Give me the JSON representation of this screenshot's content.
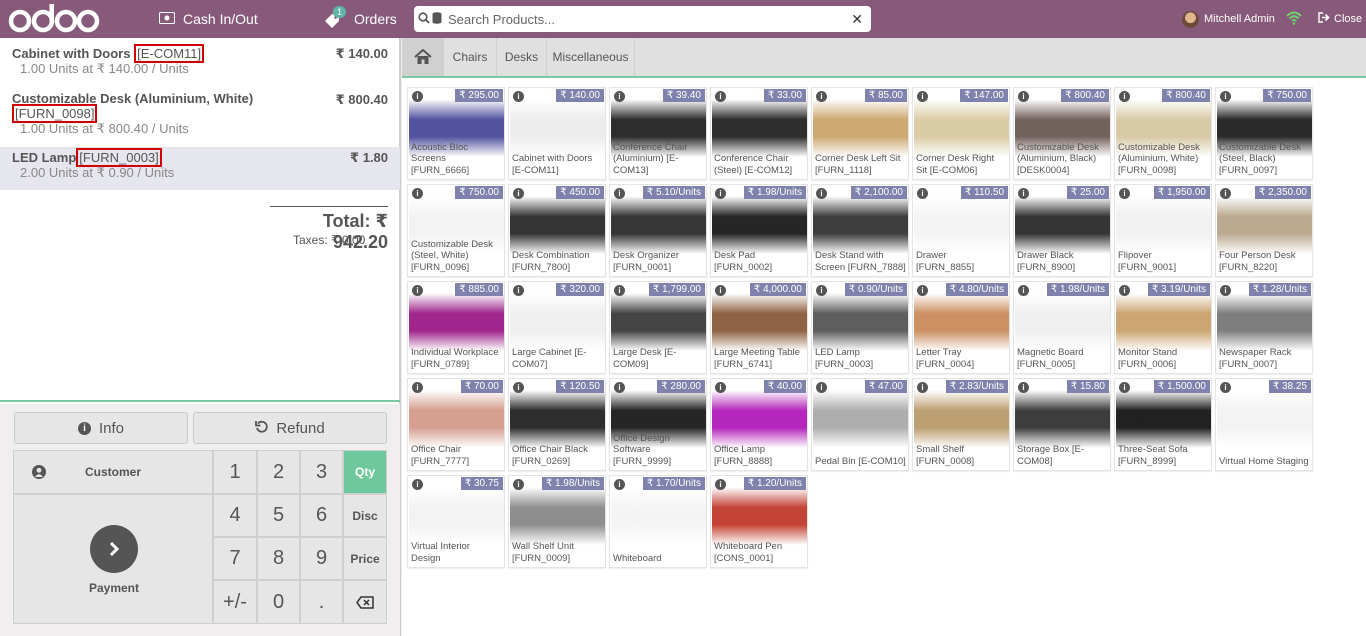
{
  "header": {
    "cash_label": "Cash In/Out",
    "orders_label": "Orders",
    "orders_badge": "1",
    "search_placeholder": "Search Products...",
    "user_name": "Mitchell Admin",
    "close_label": "Close"
  },
  "order": {
    "lines": [
      {
        "name": "Cabinet with Doors",
        "ref": "[E-COM11]",
        "price": "₹ 140.00",
        "info": "1.00 Units at ₹ 140.00 / Units"
      },
      {
        "name": "Customizable Desk (Aluminium, White)",
        "ref": "[FURN_0098]",
        "price": "₹ 800.40",
        "info": "1.00 Units at ₹ 800.40 / Units"
      },
      {
        "name": "LED Lamp",
        "ref": "[FURN_0003]",
        "price": "₹ 1.80",
        "info": "2.00 Units at ₹ 0.90 / Units"
      }
    ],
    "total": "Total: ₹ 942.20",
    "taxes": "Taxes: ₹ 0.00"
  },
  "controls": {
    "info_label": "Info",
    "refund_label": "Refund",
    "customer_label": "Customer",
    "payment_label": "Payment",
    "keys": [
      "1",
      "2",
      "3",
      "4",
      "5",
      "6",
      "7",
      "8",
      "9",
      "+/-",
      "0",
      "."
    ],
    "modes": [
      "Qty",
      "Disc",
      "Price"
    ],
    "active_mode": "Qty"
  },
  "categories": [
    "Chairs",
    "Desks",
    "Miscellaneous"
  ],
  "products": [
    {
      "name": "Acoustic Bloc Screens [FURN_6666]",
      "price": "₹ 295.00",
      "color": "#4a4a9a"
    },
    {
      "name": "Cabinet with Doors [E-COM11]",
      "price": "₹ 140.00",
      "color": "#ececec"
    },
    {
      "name": "Conference Chair (Aluminium) [E-COM13]",
      "price": "₹ 39.40",
      "color": "#222222"
    },
    {
      "name": "Conference Chair (Steel) [E-COM12]",
      "price": "₹ 33.00",
      "color": "#222222"
    },
    {
      "name": "Corner Desk Left Sit [FURN_1118]",
      "price": "₹ 85.00",
      "color": "#c9a46a"
    },
    {
      "name": "Corner Desk Right Sit [E-COM06]",
      "price": "₹ 147.00",
      "color": "#d8c9a0"
    },
    {
      "name": "Customizable Desk (Aluminium, Black) [DESK0004]",
      "price": "₹ 800.40",
      "color": "#6b5a55"
    },
    {
      "name": "Customizable Desk (Aluminium, White) [FURN_0098]",
      "price": "₹ 800.40",
      "color": "#d6c7a2"
    },
    {
      "name": "Customizable Desk (Steel, Black) [FURN_0097]",
      "price": "₹ 750.00",
      "color": "#1f1f1f"
    },
    {
      "name": "Customizable Desk (Steel, White) [FURN_0096]",
      "price": "₹ 750.00",
      "color": "#f2f2f2"
    },
    {
      "name": "Desk Combination [FURN_7800]",
      "price": "₹ 450.00",
      "color": "#2a2a2a"
    },
    {
      "name": "Desk Organizer [FURN_0001]",
      "price": "₹ 5.10/Units",
      "color": "#2b2b2b"
    },
    {
      "name": "Desk Pad [FURN_0002]",
      "price": "₹ 1.98/Units",
      "color": "#1a1a1a"
    },
    {
      "name": "Desk Stand with Screen [FURN_7888]",
      "price": "₹ 2,100.00",
      "color": "#333333"
    },
    {
      "name": "Drawer [FURN_8855]",
      "price": "₹ 110.50",
      "color": "#f4f4f4"
    },
    {
      "name": "Drawer Black [FURN_8900]",
      "price": "₹ 25.00",
      "color": "#2a2a2a"
    },
    {
      "name": "Flipover [FURN_9001]",
      "price": "₹ 1,950.00",
      "color": "#f0f0f0"
    },
    {
      "name": "Four Person Desk [FURN_8220]",
      "price": "₹ 2,350.00",
      "color": "#b7a58a"
    },
    {
      "name": "Individual Workplace [FURN_0789]",
      "price": "₹ 885.00",
      "color": "#9a1a86"
    },
    {
      "name": "Large Cabinet [E-COM07]",
      "price": "₹ 320.00",
      "color": "#eeeeee"
    },
    {
      "name": "Large Desk [E-COM09]",
      "price": "₹ 1,799.00",
      "color": "#3a3a3a"
    },
    {
      "name": "Large Meeting Table [FURN_6741]",
      "price": "₹ 4,000.00",
      "color": "#8a5a3a"
    },
    {
      "name": "LED Lamp [FURN_0003]",
      "price": "₹ 0.90/Units",
      "color": "#555555"
    },
    {
      "name": "Letter Tray [FURN_0004]",
      "price": "₹ 4.80/Units",
      "color": "#c98a5a"
    },
    {
      "name": "Magnetic Board [FURN_0005]",
      "price": "₹ 1.98/Units",
      "color": "#eeeeee"
    },
    {
      "name": "Monitor Stand [FURN_0006]",
      "price": "₹ 3.19/Units",
      "color": "#c9a06a"
    },
    {
      "name": "Newspaper Rack [FURN_0007]",
      "price": "₹ 1.28/Units",
      "color": "#777777"
    },
    {
      "name": "Office Chair [FURN_7777]",
      "price": "₹ 70.00",
      "color": "#d49a8a"
    },
    {
      "name": "Office Chair Black [FURN_0269]",
      "price": "₹ 120.50",
      "color": "#222222"
    },
    {
      "name": "Office Design Software [FURN_9999]",
      "price": "₹ 280.00",
      "color": "#1a1a1a"
    },
    {
      "name": "Office Lamp [FURN_8888]",
      "price": "₹ 40.00",
      "color": "#b01ab8"
    },
    {
      "name": "Pedal Bin [E-COM10]",
      "price": "₹ 47.00",
      "color": "#aaaaaa"
    },
    {
      "name": "Small Shelf [FURN_0008]",
      "price": "₹ 2.83/Units",
      "color": "#b89a6a"
    },
    {
      "name": "Storage Box [E-COM08]",
      "price": "₹ 15.80",
      "color": "#333333"
    },
    {
      "name": "Three-Seat Sofa [FURN_8999]",
      "price": "₹ 1,500.00",
      "color": "#151515"
    },
    {
      "name": "Virtual Home Staging",
      "price": "₹ 38.25",
      "color": "#f2f2f2"
    },
    {
      "name": "Virtual Interior Design",
      "price": "₹ 30.75",
      "color": "#f2f2f2"
    },
    {
      "name": "Wall Shelf Unit [FURN_0009]",
      "price": "₹ 1.98/Units",
      "color": "#888888"
    },
    {
      "name": "Whiteboard",
      "price": "₹ 1.70/Units",
      "color": "#f4f4f4"
    },
    {
      "name": "Whiteboard Pen [CONS_0001]",
      "price": "₹ 1.20/Units",
      "color": "#c0392b"
    }
  ],
  "colors": {
    "brand": "#875a7b",
    "accent": "#6ec89b",
    "price_tag": "#7f82ac",
    "highlight": "#d10000"
  }
}
